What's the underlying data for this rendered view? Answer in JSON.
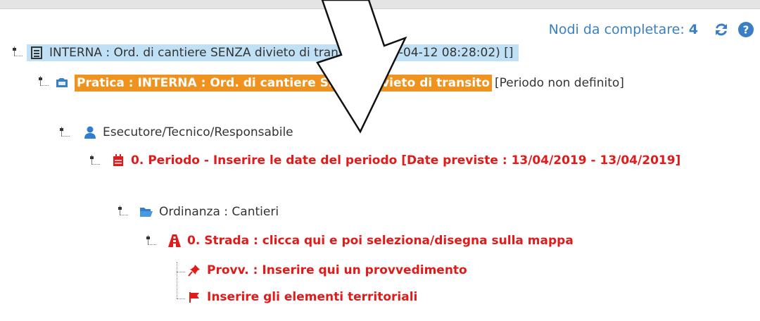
{
  "header": {
    "label": "Nodi da completare:",
    "count": "4",
    "refresh_icon": "refresh-icon",
    "help_icon": "help-icon"
  },
  "tree": {
    "root": {
      "label": "INTERNA : Ord. di cantiere SENZA divieto di transito (2019-04-12 08:28:02) []",
      "icon": "document-icon"
    },
    "pratica": {
      "label": "Pratica : INTERNA : Ord. di cantiere SENZA divieto di transito",
      "suffix": "[Periodo non definito]",
      "icon": "folder-icon"
    },
    "esecutore": {
      "label": "Esecutore/Tecnico/Responsabile",
      "icon": "user-icon"
    },
    "periodo": {
      "label": "0. Periodo - Inserire le date del periodo [Date previste : 13/04/2019 - 13/04/2019]",
      "icon": "calendar-icon"
    },
    "ordinanza": {
      "label": "Ordinanza : Cantieri",
      "icon": "open-folder-icon"
    },
    "strada": {
      "label": "0. Strada : clicca qui e poi seleziona/disegna sulla mappa",
      "icon": "road-icon"
    },
    "provv": {
      "label": "Provv. : Inserire qui un provvedimento",
      "icon": "pin-icon"
    },
    "elementi": {
      "label": "Inserire gli elementi territoriali",
      "icon": "flag-icon"
    }
  },
  "colors": {
    "accent": "#3a7fc4",
    "highlight": "#f0921e",
    "selected": "#bfe0f5",
    "error": "#e11a1a"
  }
}
